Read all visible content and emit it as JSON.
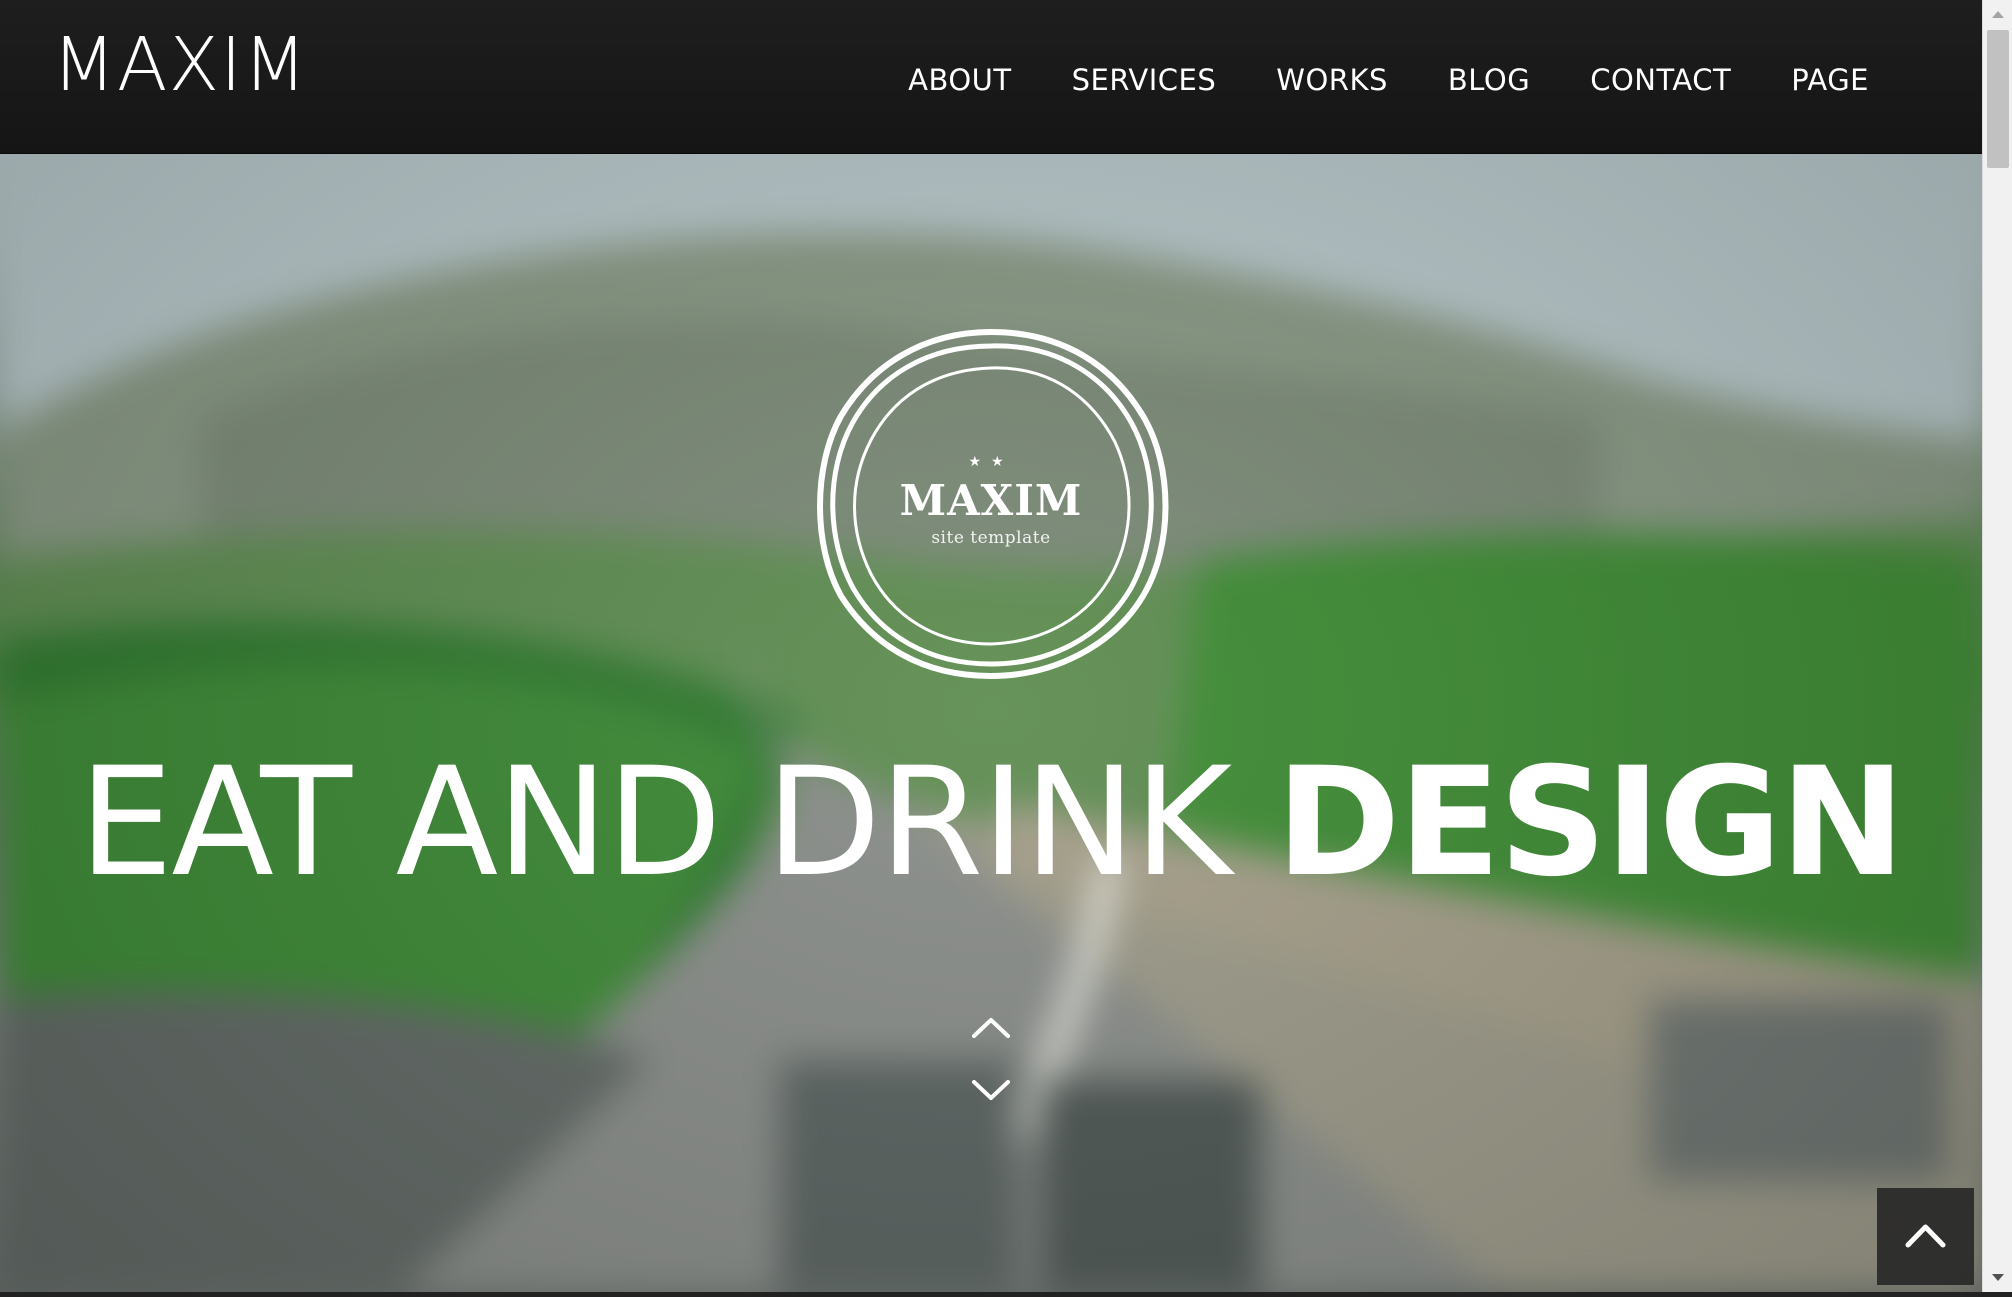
{
  "header": {
    "brand": "MAXIM",
    "nav": [
      "ABOUT",
      "SERVICES",
      "WORKS",
      "BLOG",
      "CONTACT",
      "PAGE"
    ]
  },
  "hero": {
    "emblem": {
      "stars": "★★",
      "title": "MAXIM",
      "subtitle": "site template"
    },
    "headline_light": "EAT AND DRINK",
    "headline_bold": "DESIGN"
  },
  "icons": {
    "scroll": "chevron-up-down-icon",
    "back_to_top": "chevron-up-icon"
  },
  "colors": {
    "header_bg": "#1a1a1a",
    "text": "#ffffff",
    "back_to_top_bg": "#282828"
  }
}
